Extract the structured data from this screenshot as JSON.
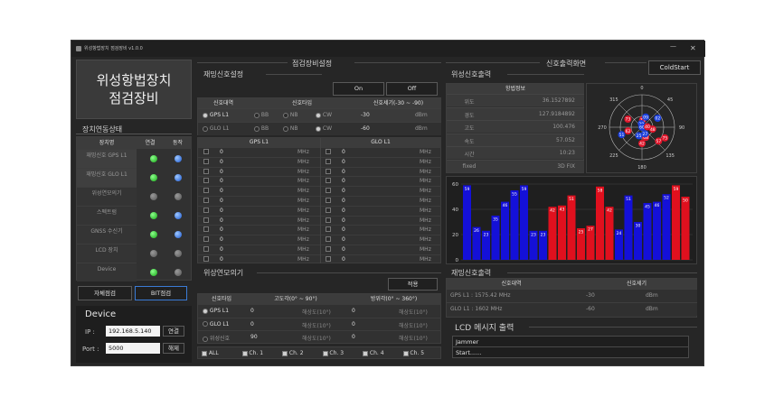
{
  "window": {
    "title": "위성항법장치 점검장비 v1.0.0"
  },
  "brand": {
    "line1": "위성항법장치",
    "line2": "점검장비"
  },
  "device_status": {
    "header": "장치연동상태",
    "col_name": "장치명",
    "col_conn": "연결",
    "col_op": "동작",
    "rows": [
      {
        "name": "재밍신호 GPS L1",
        "conn": "green",
        "op": "blue"
      },
      {
        "name": "재밍신호 GLO L1",
        "conn": "green",
        "op": "blue"
      },
      {
        "name": "위성연모의기",
        "conn": "gray",
        "op": "gray"
      },
      {
        "name": "스펙트럼",
        "conn": "green",
        "op": "blue"
      },
      {
        "name": "GNSS 수신기",
        "conn": "green",
        "op": "blue"
      },
      {
        "name": "LCD 장치",
        "conn": "gray",
        "op": "gray"
      },
      {
        "name": "Device",
        "conn": "green",
        "op": "gray"
      }
    ],
    "self_test": "자체점검",
    "bit_test": "BIT점검"
  },
  "device": {
    "title": "Device",
    "ip_label": "IP :",
    "ip": "192.168.5.140",
    "connect": "연결",
    "port_label": "Port :",
    "port": "5000",
    "disconnect": "해제"
  },
  "check_settings": {
    "header": "점검장비설정",
    "jam_header": "재밍신호설정",
    "on": "On",
    "off": "Off",
    "col_band": "신호대역",
    "col_type": "신호타입",
    "col_power": "신호세기(-30 ~ -90)",
    "rows": [
      {
        "band": "GPS L1",
        "bb": "BB",
        "nb": "NB",
        "cw": "CW",
        "power": "-30",
        "unit": "dBm"
      },
      {
        "band": "GLO L1",
        "bb": "BB",
        "nb": "NB",
        "cw": "CW",
        "power": "-60",
        "unit": "dBm"
      }
    ],
    "gps_header": "GPS L1",
    "glo_header": "GLO L1",
    "freq_value": "0",
    "freq_unit": "MHz"
  },
  "sim": {
    "header": "위상연모의기",
    "apply": "적용",
    "col_type": "신호타입",
    "col_elev": "고도각(0° ~ 90°)",
    "col_az": "방위각(0° ~ 360°)",
    "rows": [
      {
        "type": "GPS L1",
        "elev": "0",
        "elev_ph": "해상도(10°)",
        "az": "0",
        "az_ph": "해상도(10°)"
      },
      {
        "type": "GLO L1",
        "elev": "0",
        "elev_ph": "해상도(10°)",
        "az": "0",
        "az_ph": "해상도(10°)"
      },
      {
        "type": "위성신호",
        "elev": "90",
        "elev_ph": "해상도(10°)",
        "az": "0",
        "az_ph": "해상도(10°)"
      }
    ],
    "channels": [
      "ALL",
      "Ch. 1",
      "Ch. 2",
      "Ch. 3",
      "Ch. 4",
      "Ch. 5"
    ]
  },
  "output": {
    "header": "신호출력화면",
    "cold_start": "ColdStart",
    "sat_header": "위성신호출력",
    "nav_header": "항법정보",
    "nav": [
      {
        "k": "위도",
        "v": "36.1527892"
      },
      {
        "k": "경도",
        "v": "127.9184892"
      },
      {
        "k": "고도",
        "v": "100.476"
      },
      {
        "k": "속도",
        "v": "57.052"
      },
      {
        "k": "시간",
        "v": "10:23"
      },
      {
        "k": "fixed",
        "v": "3D FIX"
      }
    ],
    "jam_out_header": "재밍신호출력",
    "jam_col_band": "신호대역",
    "jam_col_power": "신호세기",
    "jam_rows": [
      {
        "band": "GPS L1 : 1575.42 MHz",
        "power": "-30",
        "unit": "dBm"
      },
      {
        "band": "GLO L1 : 1602 MHz",
        "power": "-60",
        "unit": "dBm"
      }
    ],
    "lcd_header": "LCD 메시지 출력",
    "lcd_lines": [
      "Jammer",
      "Start......"
    ]
  },
  "skyplot": {
    "labels": {
      "0": "0",
      "45": "45",
      "90": "90",
      "135": "135",
      "180": "180",
      "225": "225",
      "270": "270",
      "315": "315"
    },
    "rings": [
      "30",
      "60",
      "90"
    ],
    "sats": [
      {
        "id": "73",
        "az": 5,
        "el": 70,
        "c": "red"
      },
      {
        "id": "28",
        "az": 350,
        "el": 80,
        "c": "blue"
      },
      {
        "id": "09",
        "az": 20,
        "el": 60,
        "c": "blue"
      },
      {
        "id": "73",
        "az": 300,
        "el": 45,
        "c": "red"
      },
      {
        "id": "60",
        "az": 10,
        "el": 90,
        "c": "blue"
      },
      {
        "id": "48",
        "az": 100,
        "el": 60,
        "c": "red"
      },
      {
        "id": "40",
        "az": 85,
        "el": 75,
        "c": "red"
      },
      {
        "id": "02",
        "az": 60,
        "el": 40,
        "c": "blue"
      },
      {
        "id": "75",
        "az": 115,
        "el": 20,
        "c": "red"
      },
      {
        "id": "57",
        "az": 130,
        "el": 30,
        "c": "red"
      },
      {
        "id": "08",
        "az": 160,
        "el": 60,
        "c": "red"
      },
      {
        "id": "42",
        "az": 180,
        "el": 45,
        "c": "red"
      },
      {
        "id": "27",
        "az": 155,
        "el": 70,
        "c": "blue"
      },
      {
        "id": "25",
        "az": 200,
        "el": 65,
        "c": "blue"
      },
      {
        "id": "51",
        "az": 250,
        "el": 30,
        "c": "blue"
      },
      {
        "id": "62",
        "az": 255,
        "el": 50,
        "c": "red"
      }
    ]
  },
  "chart_data": {
    "type": "bar",
    "ylim": [
      0,
      60
    ],
    "yticks": [
      0,
      20,
      40,
      60
    ],
    "series": [
      {
        "color": "blue",
        "values": [
          59,
          26,
          23,
          35,
          46,
          55,
          59,
          23,
          23
        ]
      },
      {
        "color": "red",
        "values": [
          42,
          43,
          51,
          25,
          27,
          58,
          42
        ]
      },
      {
        "color": "blue",
        "values": [
          24,
          51,
          30,
          45,
          46,
          52
        ]
      },
      {
        "color": "red",
        "values": [
          59,
          50
        ]
      }
    ]
  }
}
